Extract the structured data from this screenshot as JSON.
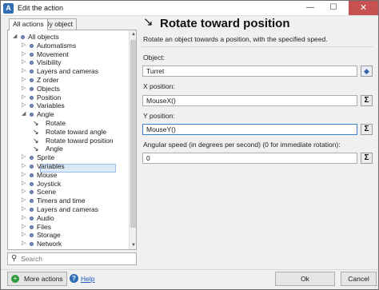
{
  "window": {
    "title": "Edit the action"
  },
  "tabs": [
    {
      "label": "All actions",
      "active": true
    },
    {
      "label": "By object",
      "active": false
    }
  ],
  "tree": [
    {
      "label": "All objects",
      "expander": "◢",
      "icon": "bullet"
    },
    {
      "label": "Automatisms",
      "expander": "▷",
      "icon": "bullet"
    },
    {
      "label": "Movement",
      "expander": "▷",
      "icon": "bullet"
    },
    {
      "label": "Visibility",
      "expander": "▷",
      "icon": "bullet"
    },
    {
      "label": "Layers and cameras",
      "expander": "▷",
      "icon": "bullet"
    },
    {
      "label": "Z order",
      "expander": "▷",
      "icon": "bullet"
    },
    {
      "label": "Objects",
      "expander": "▷",
      "icon": "bullet"
    },
    {
      "label": "Position",
      "expander": "▷",
      "icon": "bullet"
    },
    {
      "label": "Variables",
      "expander": "▷",
      "icon": "bullet"
    },
    {
      "label": "Angle",
      "expander": "◢",
      "icon": "bullet"
    },
    {
      "label": "Rotate",
      "expander": "",
      "icon": "rotate-arrow"
    },
    {
      "label": "Rotate toward angle",
      "expander": "",
      "icon": "rotate-arrow"
    },
    {
      "label": "Rotate toward position",
      "expander": "",
      "icon": "rotate-arrow",
      "selected": true
    },
    {
      "label": "Angle",
      "expander": "",
      "icon": "rotate-arrow"
    },
    {
      "label": "Sprite",
      "expander": "▷",
      "icon": "bullet"
    },
    {
      "label": "Variables",
      "expander": "▷",
      "icon": "bullet"
    },
    {
      "label": "Mouse",
      "expander": "▷",
      "icon": "bullet"
    },
    {
      "label": "Joystick",
      "expander": "▷",
      "icon": "bullet"
    },
    {
      "label": "Scene",
      "expander": "▷",
      "icon": "bullet"
    },
    {
      "label": "Timers and time",
      "expander": "▷",
      "icon": "bullet"
    },
    {
      "label": "Layers and cameras",
      "expander": "▷",
      "icon": "bullet"
    },
    {
      "label": "Audio",
      "expander": "▷",
      "icon": "bullet"
    },
    {
      "label": "Files",
      "expander": "▷",
      "icon": "bullet"
    },
    {
      "label": "Storage",
      "expander": "▷",
      "icon": "bullet"
    },
    {
      "label": "Network",
      "expander": "▷",
      "icon": "bullet"
    }
  ],
  "search": {
    "placeholder": "Search",
    "value": ""
  },
  "action": {
    "title": "Rotate toward position",
    "description": "Rotate an object towards a position, with the specified speed."
  },
  "params": [
    {
      "label": "Object:",
      "value": "Turret",
      "button_icon": "object-picker-icon"
    },
    {
      "label": "X position:",
      "value": "MouseX()",
      "button_icon": "expression-editor-icon"
    },
    {
      "label": "Y position:",
      "value": "MouseY()",
      "button_icon": "expression-editor-icon"
    },
    {
      "label": "Angular speed (in degrees per second) (0 for immediate rotation):",
      "value": "0",
      "button_icon": "expression-editor-icon"
    }
  ],
  "buttons": {
    "more_actions": "More actions",
    "help": "Help",
    "ok": "Ok",
    "cancel": "Cancel"
  }
}
